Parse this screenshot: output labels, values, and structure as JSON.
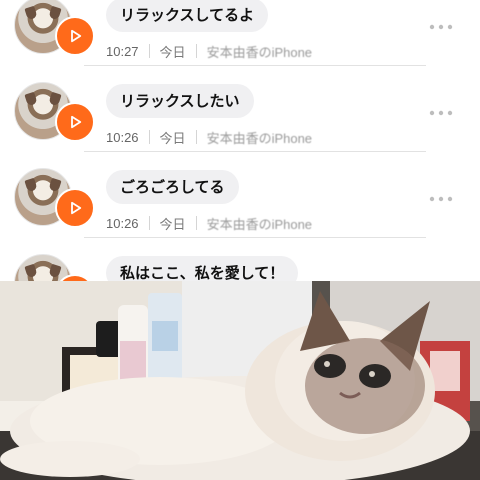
{
  "feed": {
    "items": [
      {
        "message": "リラックスしてるよ",
        "time": "10:27",
        "day": "今日",
        "source": "安本由香のiPhone"
      },
      {
        "message": "リラックスしたい",
        "time": "10:26",
        "day": "今日",
        "source": "安本由香のiPhone"
      },
      {
        "message": "ごろごろしてる",
        "time": "10:26",
        "day": "今日",
        "source": "安本由香のiPhone"
      },
      {
        "message": "私はここ、私を愛して！"
      }
    ]
  },
  "icons": {
    "play": "play-icon",
    "more": "more-dots-icon",
    "avatar": "cat-avatar"
  },
  "colors": {
    "accent": "#ff6a1a",
    "bubble": "#f0f0f2",
    "meta_text": "#7a7a7a"
  }
}
